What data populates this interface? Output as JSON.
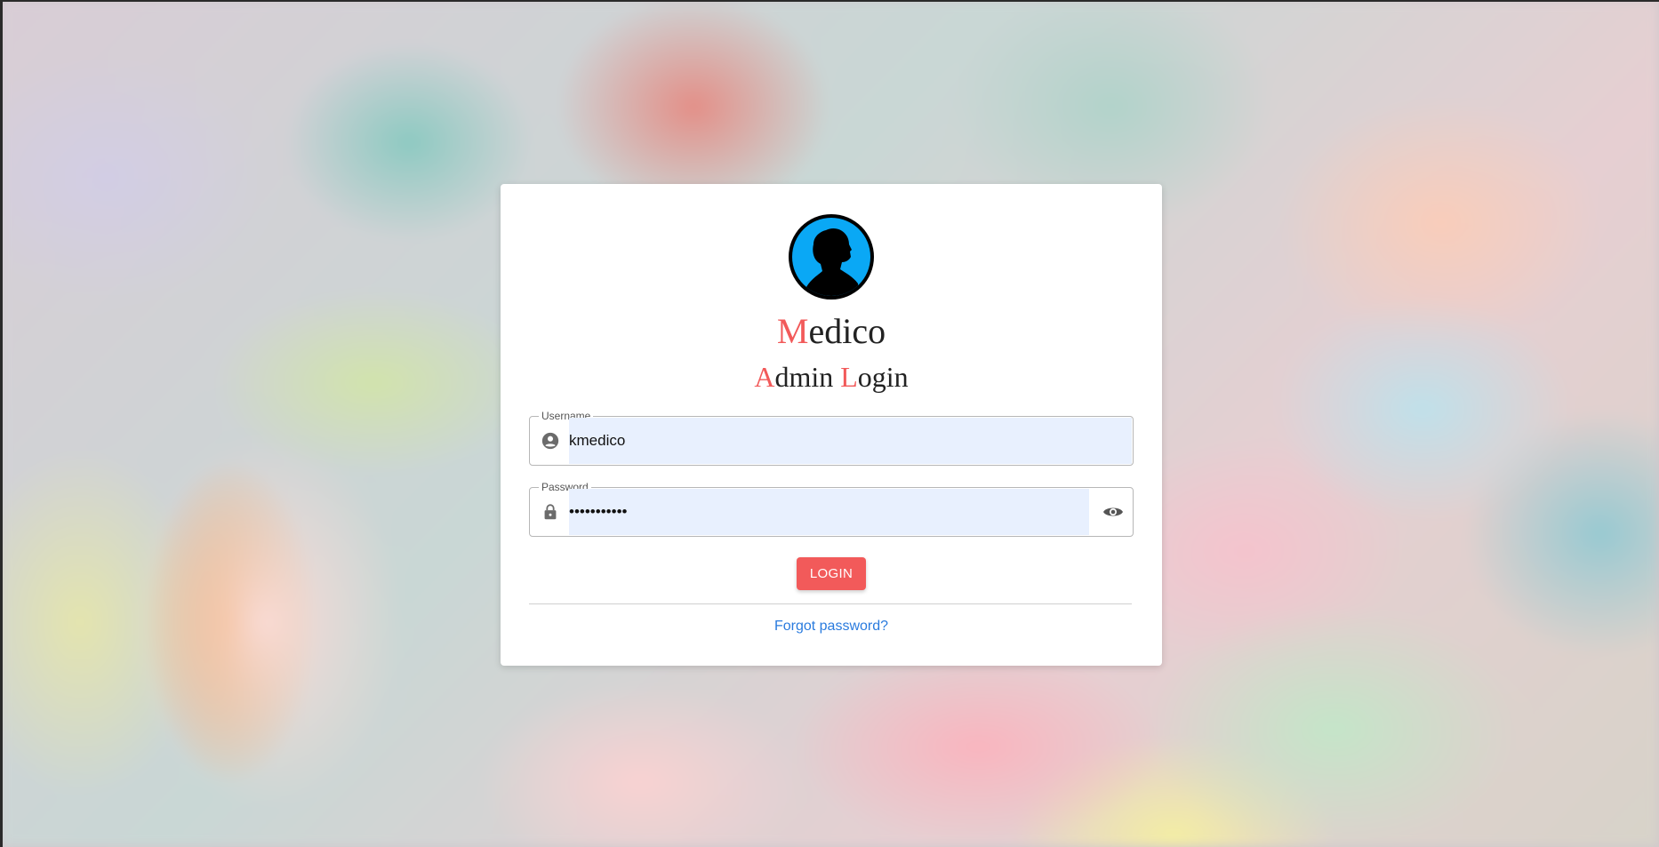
{
  "app": {
    "name_initial": "M",
    "name_rest": "edico"
  },
  "heading": {
    "word1_initial": "A",
    "word1_rest": "dmin",
    "word2_initial": "L",
    "word2_rest": "ogin"
  },
  "username": {
    "label": "Username",
    "value": "kmedico",
    "icon": "account-circle-icon"
  },
  "password": {
    "label": "Password",
    "value": "•••••••••••",
    "icon": "lock-icon",
    "toggle_icon": "eye-icon"
  },
  "login_button": {
    "label": "LOGIN"
  },
  "forgot_link": {
    "label": "Forgot password?"
  },
  "colors": {
    "accent": "#f25a5a",
    "avatar_blue": "#0aa8f5",
    "link": "#2a7bde",
    "autofill": "#e8f0fe"
  }
}
